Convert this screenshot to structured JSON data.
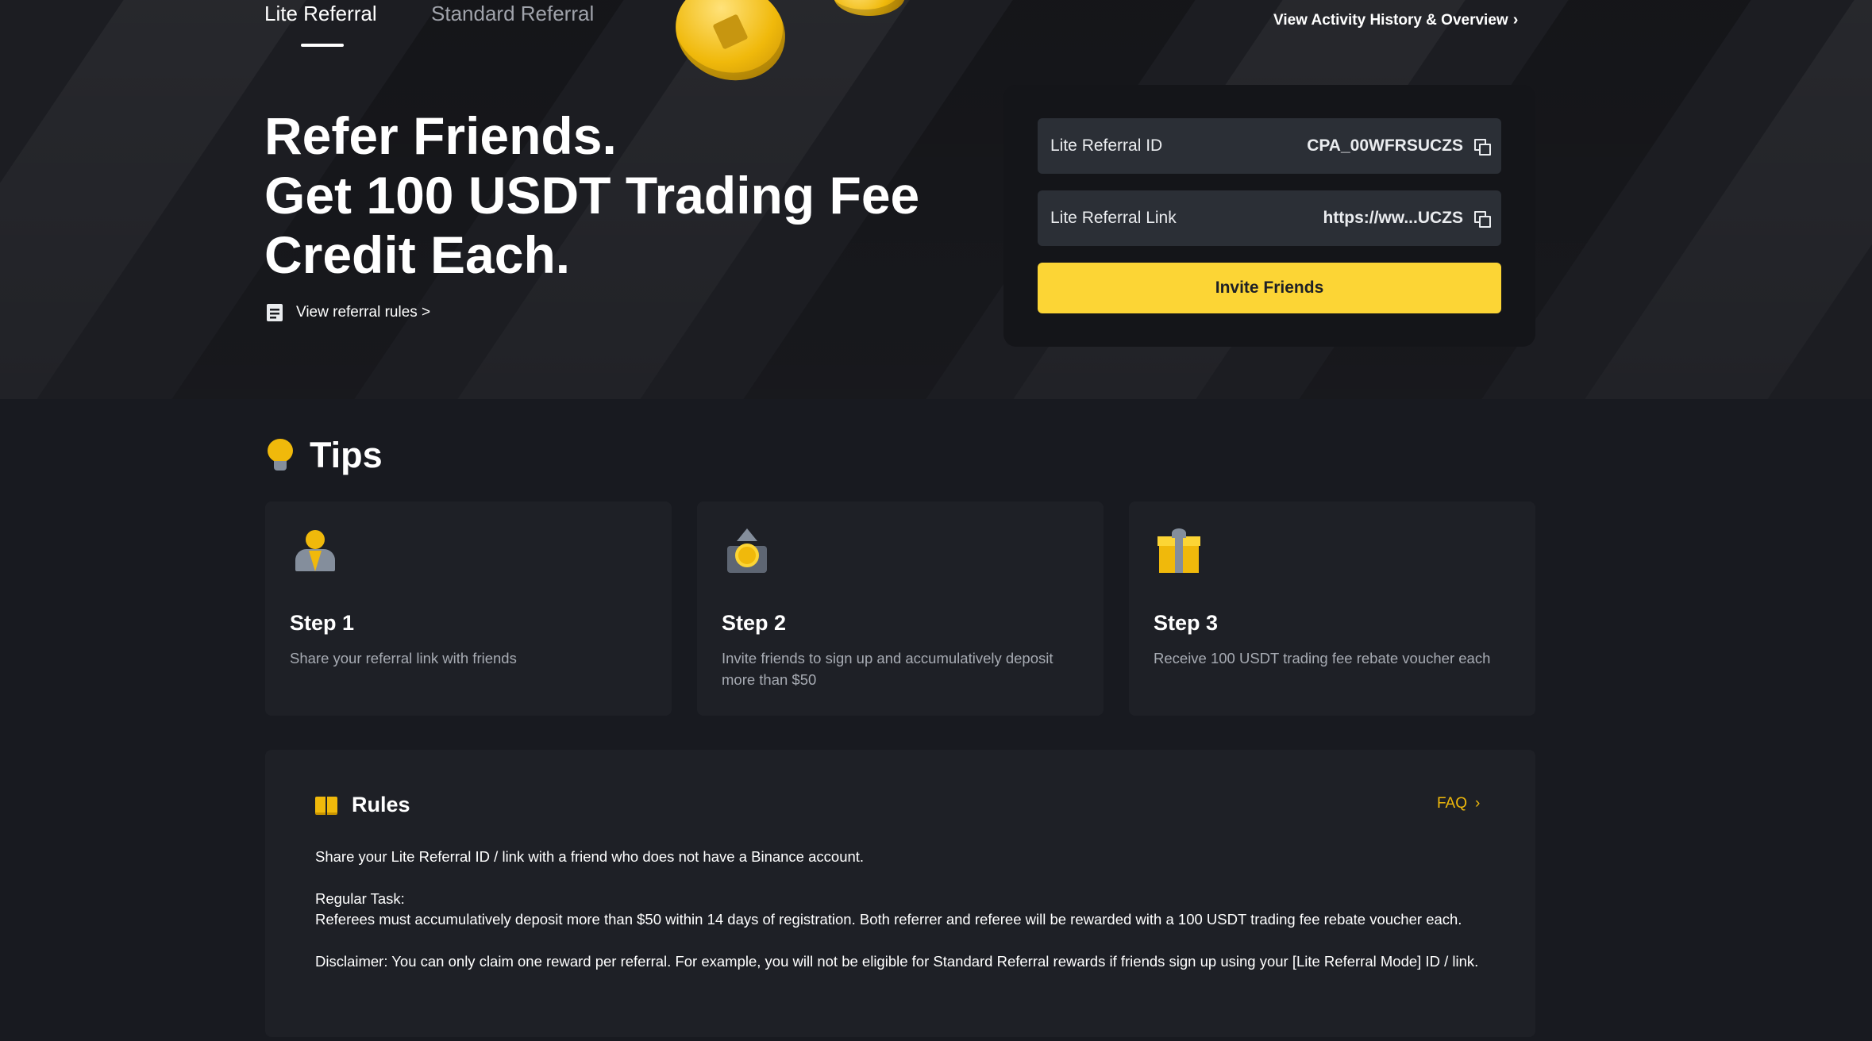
{
  "tabs": {
    "lite": "Lite Referral",
    "standard": "Standard Referral"
  },
  "activity_link": "View Activity History & Overview",
  "hero": {
    "title_line1": "Refer Friends.",
    "title_line2": "Get 100 USDT Trading Fee",
    "title_line3": "Credit Each.",
    "rules_link": "View referral rules >"
  },
  "referral_card": {
    "id_label": "Lite Referral ID",
    "id_value": "CPA_00WFRSUCZS",
    "link_label": "Lite Referral Link",
    "link_value": "https://ww...UCZS",
    "invite_button": "Invite Friends"
  },
  "tips": {
    "title": "Tips",
    "steps": [
      {
        "name": "Step 1",
        "desc": "Share your referral link with friends",
        "icon": "person-icon"
      },
      {
        "name": "Step 2",
        "desc": "Invite friends to sign up and accumulatively deposit more than $50",
        "icon": "deposit-box-icon"
      },
      {
        "name": "Step 3",
        "desc": "Receive 100 USDT trading fee rebate voucher each",
        "icon": "gift-icon"
      }
    ]
  },
  "rules": {
    "title": "Rules",
    "faq": "FAQ",
    "para1": "Share your Lite Referral ID / link with a friend who does not have a Binance account.",
    "task_heading": "Regular Task:",
    "task_text": "Referees must accumulatively deposit more than $50 within 14 days of registration. Both referrer and referee will be rewarded with a 100 USDT trading fee rebate voucher each.",
    "disclaimer": "Disclaimer: You can only claim one reward per referral. For example, you will not be eligible for Standard Referral rewards if friends sign up using your [Lite Referral Mode] ID / link."
  },
  "colors": {
    "accent": "#fcd535",
    "background": "#181a20",
    "card": "#1e2026"
  }
}
